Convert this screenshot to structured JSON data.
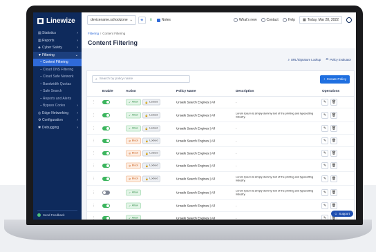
{
  "app": {
    "logo_text": "Linewize"
  },
  "sidebar": {
    "items": [
      {
        "label": "Statistics",
        "icon": "chart-icon",
        "chevron": "›",
        "state": "normal"
      },
      {
        "label": "Reports",
        "icon": "report-icon",
        "chevron": "›",
        "state": "normal"
      },
      {
        "label": "Cyber Safety",
        "icon": "shield-icon",
        "chevron": "›",
        "state": "normal"
      },
      {
        "label": "Filtering",
        "icon": "filter-icon",
        "chevron": "⌄",
        "state": "active-parent"
      },
      {
        "label": "Content Filtering",
        "icon": "",
        "chevron": "",
        "state": "active"
      },
      {
        "label": "Cloud DNS Filtering",
        "icon": "",
        "chevron": "",
        "state": "sub"
      },
      {
        "label": "Cloud Safe Network",
        "icon": "",
        "chevron": "",
        "state": "sub"
      },
      {
        "label": "Bandwidth Quotas",
        "icon": "",
        "chevron": "",
        "state": "sub"
      },
      {
        "label": "Safe Search",
        "icon": "",
        "chevron": "",
        "state": "sub"
      },
      {
        "label": "Reports and Alerts",
        "icon": "",
        "chevron": "",
        "state": "sub"
      },
      {
        "label": "Bypass Codes",
        "icon": "",
        "chevron": "›",
        "state": "sub"
      },
      {
        "label": "Edge Networking",
        "icon": "network-icon",
        "chevron": "›",
        "state": "normal"
      },
      {
        "label": "Configuration",
        "icon": "gear-icon",
        "chevron": "›",
        "state": "normal"
      },
      {
        "label": "Debugging",
        "icon": "bug-icon",
        "chevron": "›",
        "state": "normal"
      }
    ],
    "feedback_label": "Send Feedback"
  },
  "topbar": {
    "device": "devicename.schoolzone",
    "notes_label": "Notes",
    "whats_new": "What's new",
    "contact": "Contact",
    "help": "Help",
    "date": "Today, Mar 28, 2022"
  },
  "header": {
    "breadcrumb_root": "Filtering",
    "breadcrumb_sep": "/",
    "breadcrumb_current": "Content Filtering",
    "title": "Content Filtering"
  },
  "tools": {
    "lookup": "URL/Signature Lookup",
    "evaluator": "Policy Evaluator"
  },
  "search": {
    "placeholder": "Search by policy name"
  },
  "create_button": "Create Policy",
  "table": {
    "headers": {
      "enable": "Enable",
      "action": "Action",
      "policy": "Policy Name",
      "description": "Description",
      "operations": "Operations"
    },
    "rows": [
      {
        "enabled": true,
        "action": "Allow",
        "locked": "Locked",
        "policy": "Unsafe Search Engines | All",
        "description": "-"
      },
      {
        "enabled": true,
        "action": "Allow",
        "locked": "Locked",
        "policy": "Unsafe Search Engines | All",
        "description": "Lorem Ipsum is simply dummy text of the printing and typesetting industry."
      },
      {
        "enabled": true,
        "action": "Allow",
        "locked": "Locked",
        "policy": "Unsafe Search Engines | All",
        "description": "-"
      },
      {
        "enabled": true,
        "action": "Block",
        "locked": "Locked",
        "policy": "Unsafe Search Engines | All",
        "description": "-"
      },
      {
        "enabled": true,
        "action": "Block",
        "locked": "Locked",
        "policy": "Unsafe Search Engines | All",
        "description": "-"
      },
      {
        "enabled": true,
        "action": "Block",
        "locked": "Locked",
        "policy": "Unsafe Search Engines | All",
        "description": "-"
      },
      {
        "enabled": true,
        "action": "Block",
        "locked": "Locked",
        "policy": "Unsafe Search Engines | All",
        "description": "Lorem Ipsum is simply dummy text of the printing and typesetting industry."
      },
      {
        "enabled": false,
        "action": "Allow",
        "locked": "",
        "policy": "Unsafe Search Engines | All",
        "description": "Lorem Ipsum is simply dummy text of the printing and typesetting industry."
      },
      {
        "enabled": true,
        "action": "Allow",
        "locked": "",
        "policy": "Unsafe Search Engines | All",
        "description": "-"
      },
      {
        "enabled": true,
        "action": "Allow",
        "locked": "",
        "policy": "Unsafe Search Engines | All",
        "description": "-"
      },
      {
        "enabled": true,
        "action": "Allow",
        "locked": "Locked",
        "policy": "Unsafe Search Engines | All",
        "description": ""
      }
    ]
  },
  "support_label": "Support",
  "colors": {
    "sidebar": "#0e2a5c",
    "accent": "#1f6fe0",
    "toggle_on": "#3cb55e",
    "allow": "#2d8c46",
    "block": "#c85a16"
  }
}
